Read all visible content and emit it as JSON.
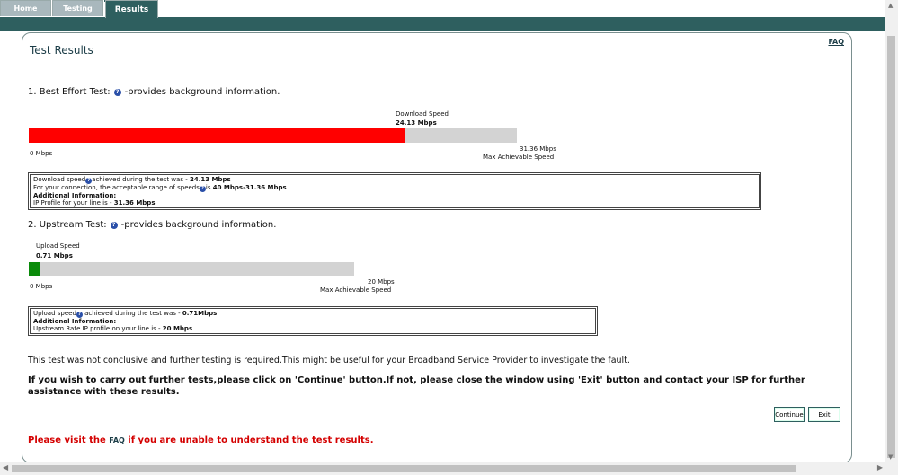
{
  "tabs": [
    "Home",
    "Testing",
    "Results"
  ],
  "panel": {
    "title": "Test Results",
    "faq_link": "FAQ"
  },
  "download": {
    "heading": "1. Best Effort Test:",
    "heading_suffix": "-provides background information.",
    "speed_label": "Download Speed",
    "speed_value": "24.13 Mbps",
    "min_label": "0 Mbps",
    "max_value": "31.36 Mbps",
    "max_label": "Max Achievable Speed",
    "measured_mbps": 24.13,
    "max_mbps": 31.36,
    "fill_color": "#ff0000",
    "info": {
      "line1_a": "Download speed",
      "line1_b": "achieved during the test was - ",
      "line1_value": "24.13 Mbps",
      "line2_a": "For your connection, the acceptable range of speeds",
      "line2_b": "is ",
      "line2_value": "40 Mbps-31.36 Mbps",
      "line2_end": " .",
      "line3": "Additional Information:",
      "line4_a": "IP Profile for your line is - ",
      "line4_value": "31.36 Mbps"
    }
  },
  "upload": {
    "heading": "2. Upstream Test:",
    "heading_suffix": "-provides background information.",
    "speed_label": "Upload Speed",
    "speed_value": "0.71 Mbps",
    "min_label": "0 Mbps",
    "max_value": "20 Mbps",
    "max_label": "Max Achievable Speed",
    "measured_mbps": 0.71,
    "max_mbps": 20,
    "fill_color": "#0a8a0a",
    "info": {
      "line1_a": "Upload speed",
      "line1_b": " achieved during the test was - ",
      "line1_value": "0.71Mbps",
      "line2": "Additional Information:",
      "line3_a": "Upstream Rate IP profile on your line is - ",
      "line3_value": "20 Mbps"
    }
  },
  "messages": {
    "inconclusive": "This test was not conclusive and further testing is required.This might be useful for your Broadband Service Provider to investigate the fault.",
    "instructions": "If you wish to carry out further tests,please click on 'Continue' button.If not, please close the window using 'Exit' button and contact your ISP for further assistance with these results."
  },
  "buttons": {
    "continue": "Continue",
    "exit": "Exit"
  },
  "footer": {
    "prefix": "Please visit the ",
    "link": "FAQ",
    "suffix": " if you are unable to understand the test results."
  },
  "colors": {
    "brand": "#2e5f5f",
    "alert": "#d40000"
  },
  "icons": [
    "help-icon"
  ]
}
